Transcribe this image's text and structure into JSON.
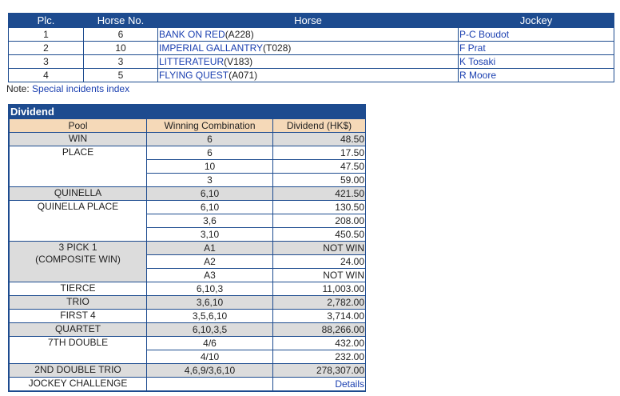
{
  "results": {
    "headers": {
      "place": "Plc.",
      "horse_no": "Horse No.",
      "horse": "Horse",
      "jockey": "Jockey"
    },
    "rows": [
      {
        "place": "1",
        "horse_no": "6",
        "horse": "BANK ON RED",
        "code": "(A228)",
        "jockey": "P-C Boudot"
      },
      {
        "place": "2",
        "horse_no": "10",
        "horse": "IMPERIAL GALLANTRY",
        "code": "(T028)",
        "jockey": "F Prat"
      },
      {
        "place": "3",
        "horse_no": "3",
        "horse": "LITTERATEUR",
        "code": "(V183)",
        "jockey": "K Tosaki"
      },
      {
        "place": "4",
        "horse_no": "5",
        "horse": "FLYING QUEST",
        "code": "(A071)",
        "jockey": "R Moore"
      }
    ]
  },
  "note": {
    "label": "Note:",
    "link": "Special incidents index"
  },
  "dividend": {
    "title": "Dividend",
    "headers": {
      "pool": "Pool",
      "combination": "Winning Combination",
      "amount": "Dividend (HK$)"
    },
    "pools": [
      {
        "name": "WIN",
        "shade": "g",
        "entries": [
          [
            "6",
            "48.50"
          ]
        ]
      },
      {
        "name": "PLACE",
        "shade": "w",
        "entries": [
          [
            "6",
            "17.50"
          ],
          [
            "10",
            "47.50"
          ],
          [
            "3",
            "59.00"
          ]
        ]
      },
      {
        "name": "QUINELLA",
        "shade": "g",
        "entries": [
          [
            "6,10",
            "421.50"
          ]
        ]
      },
      {
        "name": "QUINELLA PLACE",
        "shade": "w",
        "entries": [
          [
            "6,10",
            "130.50"
          ],
          [
            "3,6",
            "208.00"
          ],
          [
            "3,10",
            "450.50"
          ]
        ]
      },
      {
        "name": "3 PICK 1\n(COMPOSITE WIN)",
        "shade": "g",
        "entries": [
          [
            "A1",
            "NOT WIN"
          ],
          [
            "A2",
            "24.00"
          ],
          [
            "A3",
            "NOT WIN"
          ]
        ]
      },
      {
        "name": "TIERCE",
        "shade": "w",
        "entries": [
          [
            "6,10,3",
            "11,003.00"
          ]
        ]
      },
      {
        "name": "TRIO",
        "shade": "g",
        "entries": [
          [
            "3,6,10",
            "2,782.00"
          ]
        ]
      },
      {
        "name": "FIRST 4",
        "shade": "w",
        "entries": [
          [
            "3,5,6,10",
            "3,714.00"
          ]
        ]
      },
      {
        "name": "QUARTET",
        "shade": "g",
        "entries": [
          [
            "6,10,3,5",
            "88,266.00"
          ]
        ]
      },
      {
        "name": "7TH DOUBLE",
        "shade": "w",
        "entries": [
          [
            "4/6",
            "432.00"
          ],
          [
            "4/10",
            "232.00"
          ]
        ]
      },
      {
        "name": "2ND DOUBLE TRIO",
        "shade": "g",
        "entries": [
          [
            "4,6,9/3,6,10",
            "278,307.00"
          ]
        ]
      },
      {
        "name": "JOCKEY CHALLENGE",
        "shade": "w",
        "entries": [
          [
            "",
            "Details"
          ]
        ],
        "link": true
      }
    ]
  }
}
